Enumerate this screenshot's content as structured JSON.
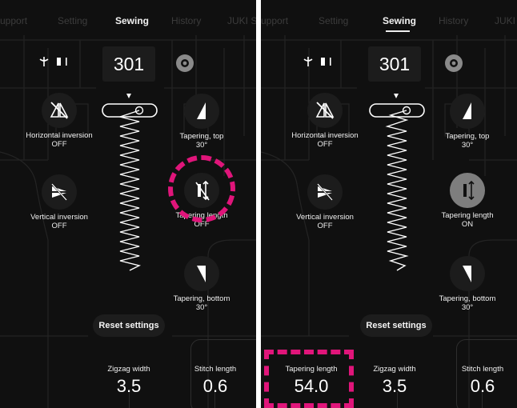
{
  "screens": [
    {
      "tabs": [
        "upport",
        "Setting",
        "Sewing",
        "History",
        "JUKI S"
      ],
      "pattern_number": "301",
      "tapering_length": {
        "title": "Tapering length",
        "state": "OFF"
      },
      "horizontal_inversion": {
        "title": "Horizontal inversion",
        "state": "OFF"
      },
      "vertical_inversion": {
        "title": "Vertical inversion",
        "state": "OFF"
      },
      "tapering_top": {
        "title": "Tapering, top",
        "value": "30°"
      },
      "tapering_bottom": {
        "title": "Tapering, bottom",
        "value": "30°"
      },
      "reset_label": "Reset settings",
      "zigzag_width": {
        "label": "Zigzag width",
        "value": "3.5"
      },
      "stitch_length": {
        "label": "Stitch length",
        "value": "0.6"
      }
    },
    {
      "tabs": [
        "upport",
        "Setting",
        "Sewing",
        "History",
        "JUKI"
      ],
      "pattern_number": "301",
      "tapering_length": {
        "title": "Tapering length",
        "state": "ON"
      },
      "horizontal_inversion": {
        "title": "Horizontal inversion",
        "state": "OFF"
      },
      "vertical_inversion": {
        "title": "Vertical inversion",
        "state": "OFF"
      },
      "tapering_top": {
        "title": "Tapering, top",
        "value": "30°"
      },
      "tapering_bottom": {
        "title": "Tapering, bottom",
        "value": "30°"
      },
      "reset_label": "Reset settings",
      "tapering_length_value": {
        "label": "Tapering length",
        "value": "54.0"
      },
      "zigzag_width": {
        "label": "Zigzag width",
        "value": "3.5"
      },
      "stitch_length": {
        "label": "Stitch length",
        "value": "0.6"
      }
    }
  ],
  "colors": {
    "background": "#101010",
    "highlight": "#e0157a",
    "control": "#1c1c1c",
    "control_on": "#7e7e7e"
  }
}
